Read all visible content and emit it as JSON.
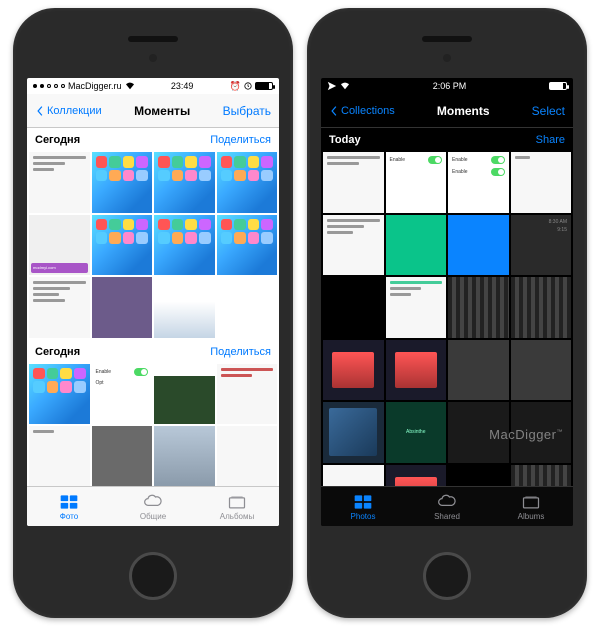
{
  "left": {
    "statusbar": {
      "carrier": "MacDigger.ru",
      "time": "23:49"
    },
    "nav": {
      "back": "Коллекции",
      "title": "Моменты",
      "select": "Выбрать"
    },
    "sections": [
      {
        "date": "Сегодня",
        "share": "Поделиться"
      },
      {
        "date": "Сегодня",
        "share": "Поделиться"
      }
    ],
    "tabs": {
      "photos": "Фото",
      "shared": "Общие",
      "albums": "Альбомы"
    }
  },
  "right": {
    "statusbar": {
      "time": "2:06 PM"
    },
    "nav": {
      "back": "Collections",
      "title": "Moments",
      "select": "Select"
    },
    "sections": [
      {
        "date": "Today",
        "share": "Share"
      }
    ],
    "tabs": {
      "photos": "Photos",
      "shared": "Shared",
      "albums": "Albums"
    },
    "watermark": "MacDigger"
  }
}
